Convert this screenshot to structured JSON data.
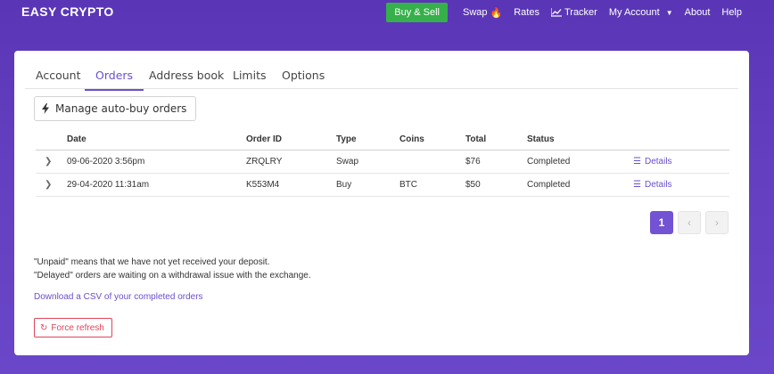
{
  "brand": "EASY CRYPTO",
  "nav": {
    "buy_sell": "Buy & Sell",
    "swap": "Swap",
    "rates": "Rates",
    "tracker": "Tracker",
    "my_account": "My Account",
    "about": "About",
    "help": "Help"
  },
  "colors": {
    "accent": "#6a4fcf",
    "buy_sell": "#36b04a",
    "danger": "#e0445a"
  },
  "tabs": [
    {
      "label": "Account"
    },
    {
      "label": "Orders",
      "active": true
    },
    {
      "label": "Address book"
    },
    {
      "label": "Limits"
    },
    {
      "label": "Options"
    }
  ],
  "autobuy_label": "Manage auto-buy orders",
  "table": {
    "headers": {
      "date": "Date",
      "order_id": "Order ID",
      "type": "Type",
      "coins": "Coins",
      "total": "Total",
      "status": "Status"
    },
    "rows": [
      {
        "date": "09-06-2020 3:56pm",
        "order_id": "ZRQLRY",
        "type": "Swap",
        "coins": "",
        "total": "$76",
        "status": "Completed",
        "details": "Details"
      },
      {
        "date": "29-04-2020 11:31am",
        "order_id": "K553M4",
        "type": "Buy",
        "coins": "BTC",
        "total": "$50",
        "status": "Completed",
        "details": "Details"
      }
    ]
  },
  "pagination": {
    "current": "1"
  },
  "notes": {
    "unpaid": "\"Unpaid\" means that we have not yet received your deposit.",
    "delayed": "\"Delayed\" orders are waiting on a withdrawal issue with the exchange."
  },
  "csv_link": "Download a CSV of your completed orders",
  "force_refresh": "Force refresh"
}
